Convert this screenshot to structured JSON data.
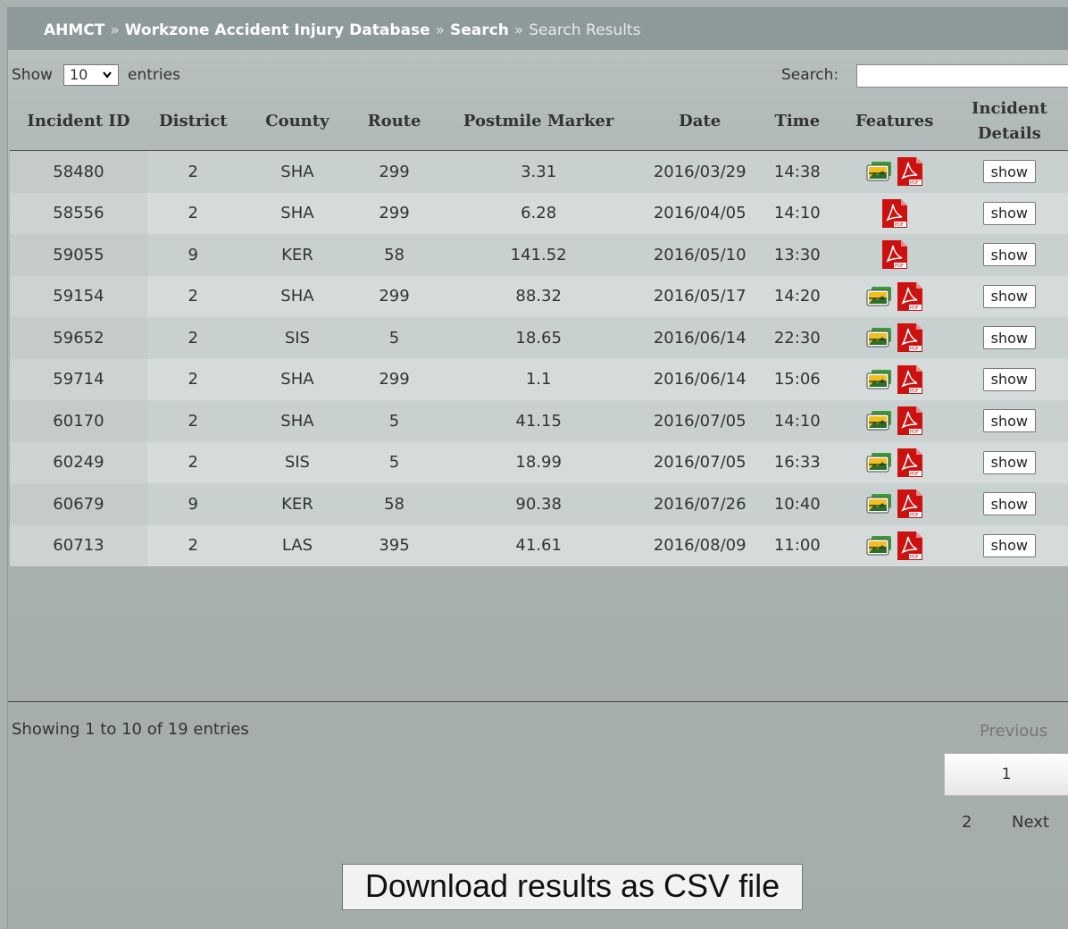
{
  "breadcrumb": {
    "items": [
      "AHMCT",
      "Workzone Accident Injury Database",
      "Search"
    ],
    "current": "Search Results",
    "separator": "»"
  },
  "controls": {
    "show_label": "Show",
    "entries_value": "10",
    "entries_label": "entries",
    "search_label": "Search:",
    "search_value": ""
  },
  "table": {
    "headers": [
      "Incident ID",
      "District",
      "County",
      "Route",
      "Postmile Marker",
      "Date",
      "Time",
      "Features",
      "Incident Details"
    ],
    "show_label": "show",
    "rows": [
      {
        "id": "58480",
        "district": "2",
        "county": "SHA",
        "route": "299",
        "postmile": "3.31",
        "date": "2016/03/29",
        "time": "14:38",
        "photo": true,
        "pdf": true
      },
      {
        "id": "58556",
        "district": "2",
        "county": "SHA",
        "route": "299",
        "postmile": "6.28",
        "date": "2016/04/05",
        "time": "14:10",
        "photo": false,
        "pdf": true
      },
      {
        "id": "59055",
        "district": "9",
        "county": "KER",
        "route": "58",
        "postmile": "141.52",
        "date": "2016/05/10",
        "time": "13:30",
        "photo": false,
        "pdf": true
      },
      {
        "id": "59154",
        "district": "2",
        "county": "SHA",
        "route": "299",
        "postmile": "88.32",
        "date": "2016/05/17",
        "time": "14:20",
        "photo": true,
        "pdf": true
      },
      {
        "id": "59652",
        "district": "2",
        "county": "SIS",
        "route": "5",
        "postmile": "18.65",
        "date": "2016/06/14",
        "time": "22:30",
        "photo": true,
        "pdf": true
      },
      {
        "id": "59714",
        "district": "2",
        "county": "SHA",
        "route": "299",
        "postmile": "1.1",
        "date": "2016/06/14",
        "time": "15:06",
        "photo": true,
        "pdf": true
      },
      {
        "id": "60170",
        "district": "2",
        "county": "SHA",
        "route": "5",
        "postmile": "41.15",
        "date": "2016/07/05",
        "time": "14:10",
        "photo": true,
        "pdf": true
      },
      {
        "id": "60249",
        "district": "2",
        "county": "SIS",
        "route": "5",
        "postmile": "18.99",
        "date": "2016/07/05",
        "time": "16:33",
        "photo": true,
        "pdf": true
      },
      {
        "id": "60679",
        "district": "9",
        "county": "KER",
        "route": "58",
        "postmile": "90.38",
        "date": "2016/07/26",
        "time": "10:40",
        "photo": true,
        "pdf": true
      },
      {
        "id": "60713",
        "district": "2",
        "county": "LAS",
        "route": "395",
        "postmile": "41.61",
        "date": "2016/08/09",
        "time": "11:00",
        "photo": true,
        "pdf": true
      }
    ]
  },
  "pagination": {
    "info": "Showing 1 to 10 of 19 entries",
    "previous": "Previous",
    "pages": [
      "1",
      "2"
    ],
    "next": "Next"
  },
  "csv_button": "Download results as CSV file",
  "icons": {
    "photo": "photo-icon",
    "pdf": "pdf-icon",
    "select_caret": "chevron-down-icon"
  },
  "colors": {
    "breadcrumb_bg": "#8e9a99",
    "pdf_red": "#cc1111"
  }
}
